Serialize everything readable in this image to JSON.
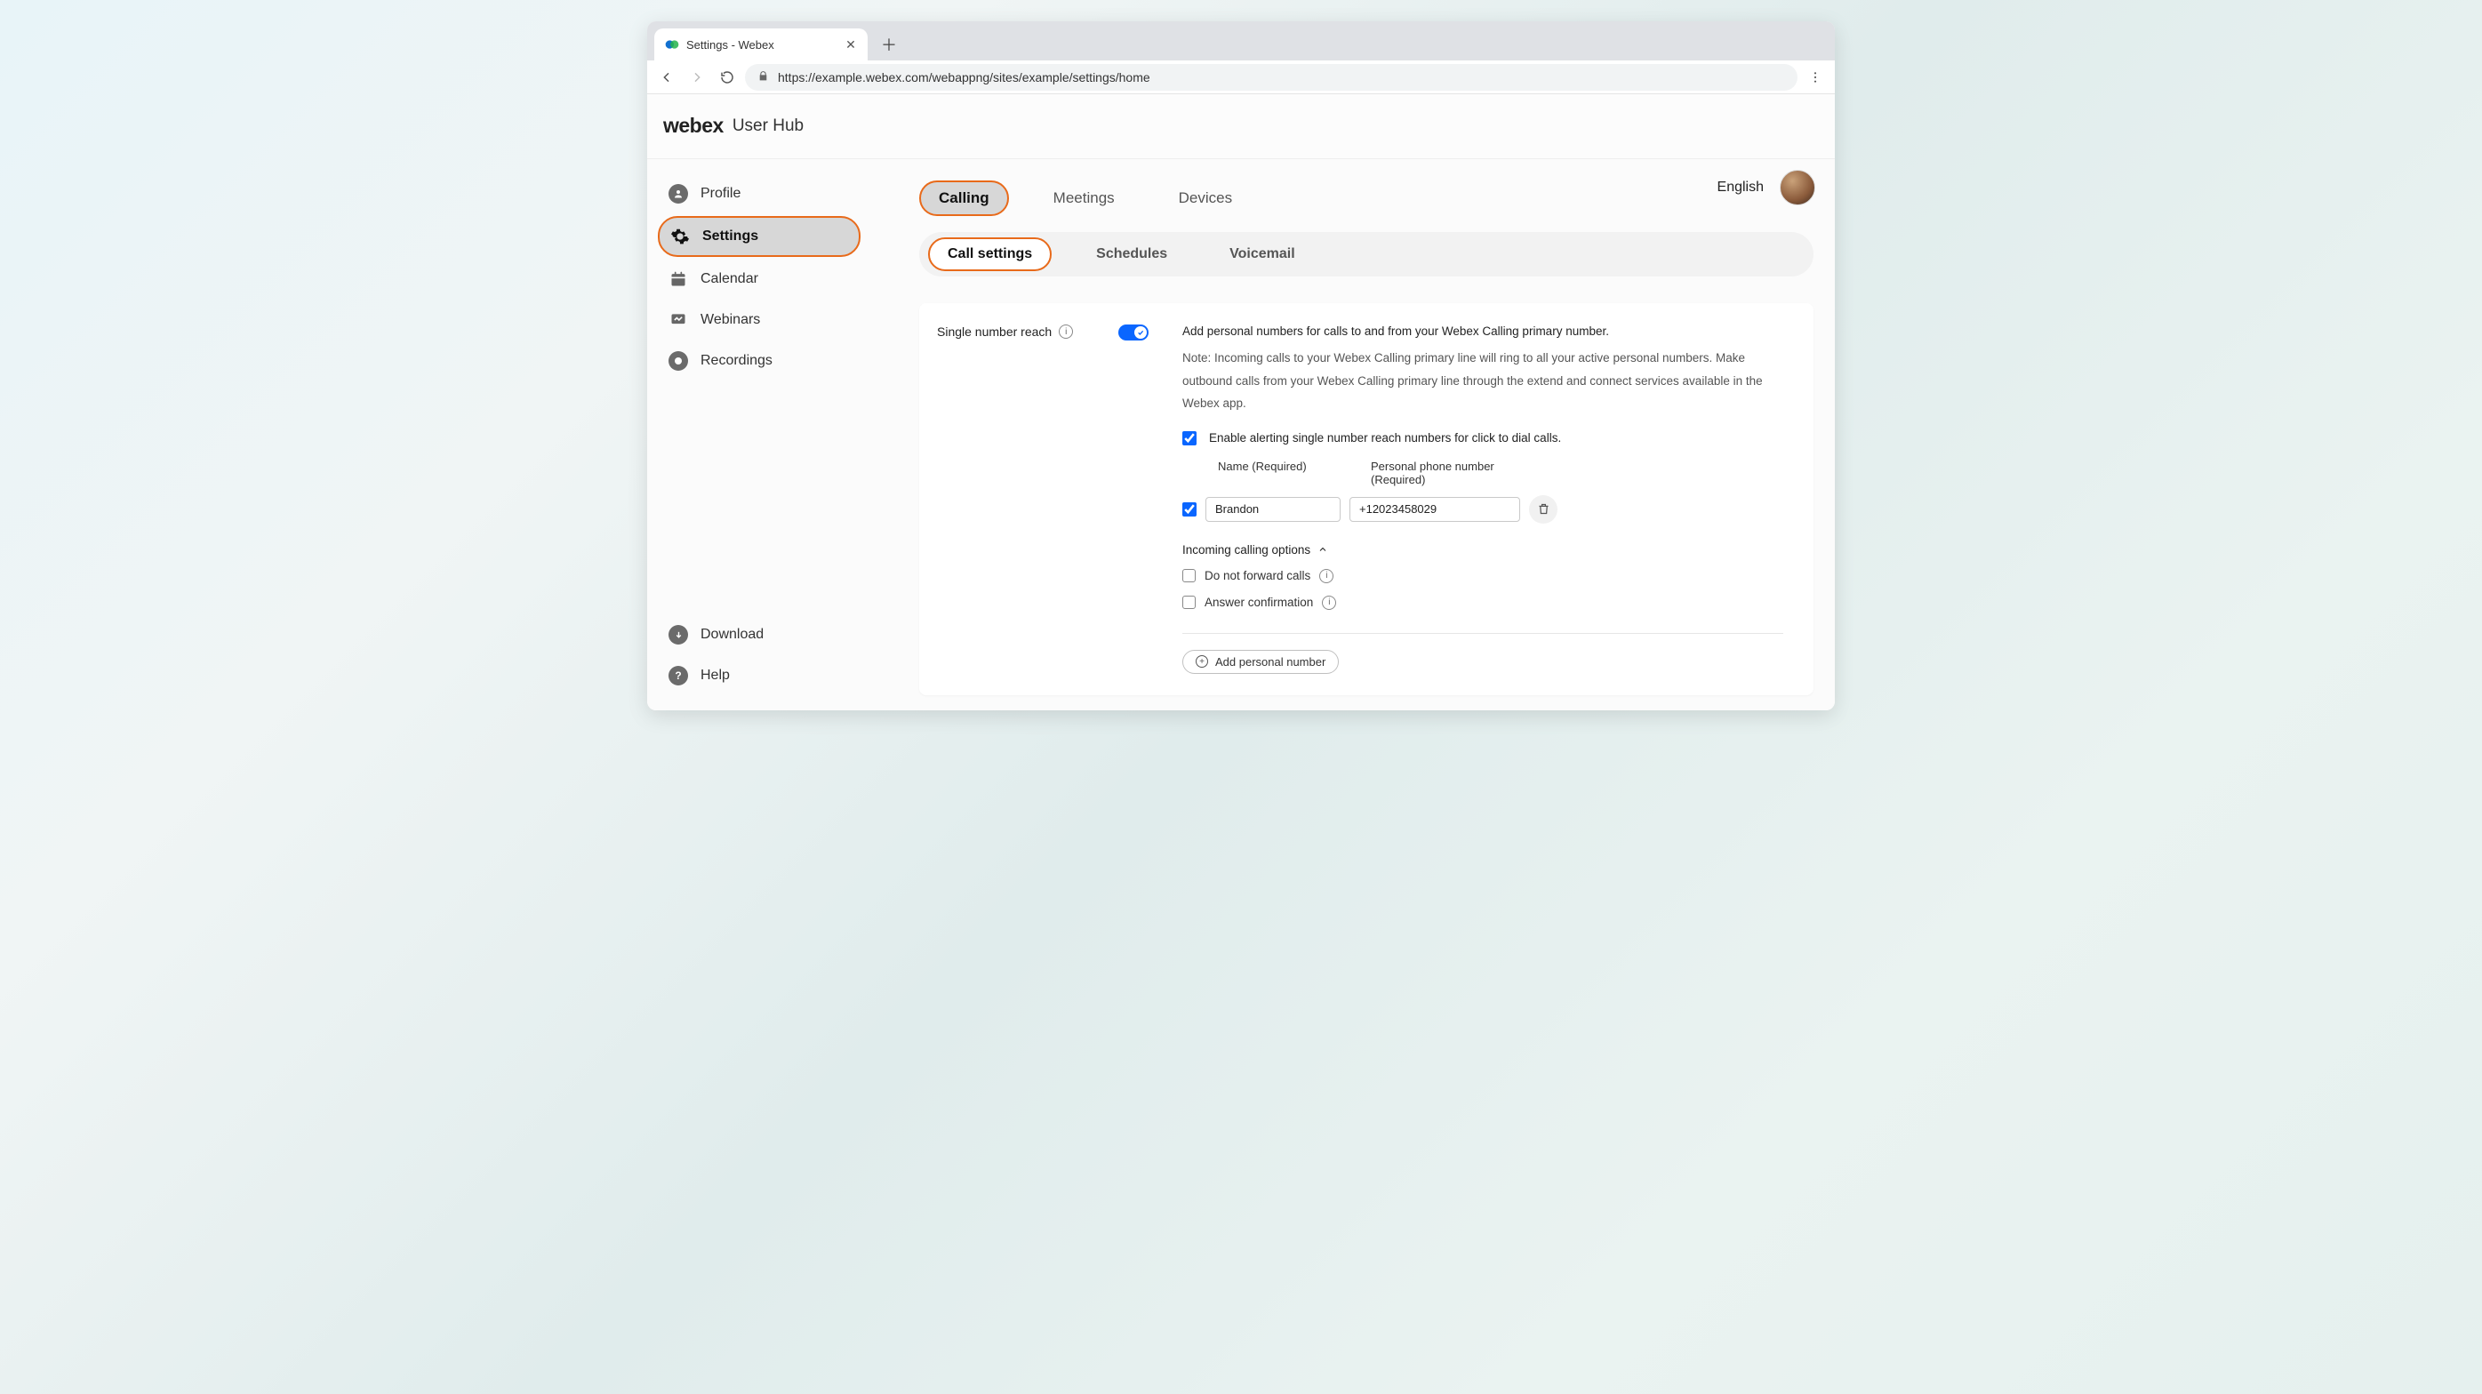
{
  "browser": {
    "tab_title": "Settings - Webex",
    "url": "https://example.webex.com/webappng/sites/example/settings/home"
  },
  "header": {
    "brand": "webex",
    "product": "User Hub",
    "language": "English"
  },
  "sidebar": {
    "items": [
      {
        "label": "Profile"
      },
      {
        "label": "Settings"
      },
      {
        "label": "Calendar"
      },
      {
        "label": "Webinars"
      },
      {
        "label": "Recordings"
      }
    ],
    "bottom": [
      {
        "label": "Download"
      },
      {
        "label": "Help"
      }
    ]
  },
  "tabs": {
    "primary": [
      "Calling",
      "Meetings",
      "Devices"
    ],
    "secondary": [
      "Call settings",
      "Schedules",
      "Voicemail"
    ]
  },
  "snr": {
    "title": "Single number reach",
    "toggle_on": true,
    "desc_title": "Add personal numbers for calls to and from your Webex Calling primary number.",
    "desc_note": "Note: Incoming calls to your Webex Calling primary line will ring to all your active personal numbers. Make outbound calls from your Webex Calling primary line through the extend and connect services available in the Webex app.",
    "alert_checkbox_label": "Enable alerting single number reach numbers for click to dial calls.",
    "alert_checkbox_checked": true,
    "columns": {
      "name": "Name (Required)",
      "phone": "Personal phone number (Required)"
    },
    "entry": {
      "checked": true,
      "name": "Brandon",
      "phone": "+12023458029"
    },
    "incoming_header": "Incoming calling options",
    "option_dnf": "Do not forward calls",
    "option_ac": "Answer confirmation",
    "add_label": "Add personal number"
  }
}
